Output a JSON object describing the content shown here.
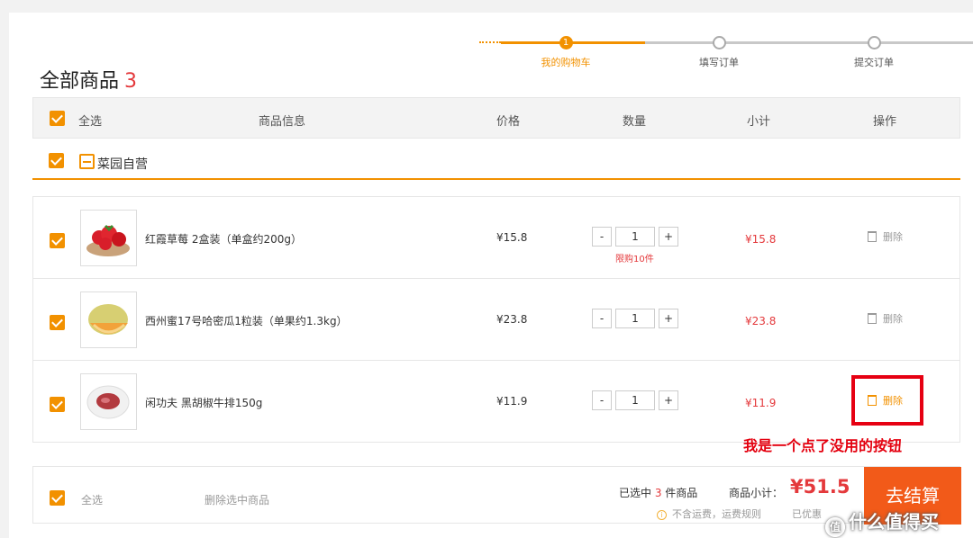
{
  "steps": [
    {
      "number": "1",
      "label": "我的购物车",
      "active": true
    },
    {
      "number": "",
      "label": "填写订单",
      "active": false
    },
    {
      "number": "",
      "label": "提交订单",
      "active": false
    }
  ],
  "cart": {
    "title": "全部商品",
    "count": "3"
  },
  "table_header": {
    "select_all": "全选",
    "product_info": "商品信息",
    "price": "价格",
    "quantity": "数量",
    "subtotal": "小计",
    "actions": "操作"
  },
  "store": {
    "name": "菜园自营"
  },
  "items": [
    {
      "name": "红霞草莓 2盒装（单盒约200g）",
      "price": "¥15.8",
      "quantity": "1",
      "limit": "限购10件",
      "subtotal": "¥15.8",
      "delete_label": "删除",
      "thumb_icon": "strawberry-image"
    },
    {
      "name": "西州蜜17号哈密瓜1粒装（单果约1.3kg）",
      "price": "¥23.8",
      "quantity": "1",
      "limit": "",
      "subtotal": "¥23.8",
      "delete_label": "删除",
      "thumb_icon": "melon-image"
    },
    {
      "name": "闲功夫 黑胡椒牛排150g",
      "price": "¥11.9",
      "quantity": "1",
      "limit": "",
      "subtotal": "¥11.9",
      "delete_label": "删除",
      "thumb_icon": "steak-image"
    }
  ],
  "qty_controls": {
    "minus": "-",
    "plus": "+"
  },
  "annotation": "我是一个点了没用的按钮",
  "footer": {
    "select_all": "全选",
    "delete_selected": "删除选中商品",
    "selected_prefix": "已选中 ",
    "selected_count": "3",
    "selected_suffix": " 件商品",
    "subtotal_label": "商品小计：",
    "total": "¥51.5",
    "shipping_note": "不含运费，运费规则",
    "saved_label": "已优惠",
    "checkout_label": "去结算"
  },
  "watermark": "值 什么值得买",
  "colors": {
    "accent": "#f29100",
    "price_red": "#e4393c",
    "checkout": "#f25a19",
    "highlight": "#e60012"
  }
}
